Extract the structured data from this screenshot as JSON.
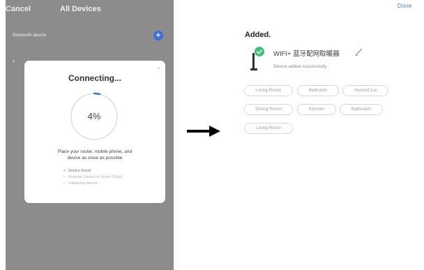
{
  "left_screen": {
    "cancel_label": "Cancel",
    "title": "All Devices",
    "bluetooth_row_label": "Bluetooth device",
    "add_icon_glyph": "+"
  },
  "connecting_modal": {
    "close_glyph": "×",
    "title": "Connecting...",
    "progress_text": "4%",
    "progress_fraction": 0.04,
    "advice_line_1": "Place your router, mobile phone, and",
    "advice_line_2": "device as close as possible",
    "steps": [
      {
        "icon": "✓",
        "label": "Device found",
        "state": "done"
      },
      {
        "icon": "○",
        "label": "Register Device to Smart Cloud.",
        "state": "pending"
      },
      {
        "icon": "○",
        "label": "Initializing device...",
        "state": "pending"
      }
    ]
  },
  "right_screen": {
    "done_label": "Done",
    "added_heading": "Added.",
    "device_name": "WIFI+ 蓝牙配网取暖器",
    "device_status": "Device added successfully",
    "rooms": [
      "Living Room",
      "Bedroom",
      "Second Lie",
      "Dining Room",
      "Kitchen",
      "Bathroom",
      "Living Room"
    ]
  },
  "colors": {
    "accent_blue": "#3d6fd8",
    "success_green": "#3fbf78",
    "overlay_gray": "#8c8c8c"
  }
}
